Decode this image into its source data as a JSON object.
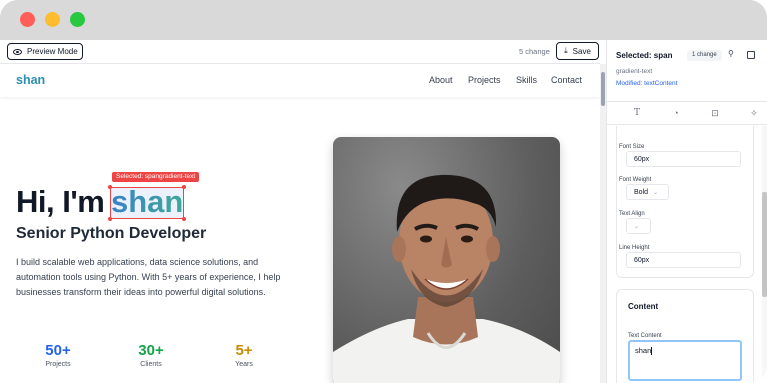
{
  "toolbar": {
    "preview_label": "Preview Mode",
    "changes_text": "5 change",
    "save_label": "Save"
  },
  "site": {
    "logo": "shan",
    "nav": [
      "About",
      "Projects",
      "Skills",
      "Contact"
    ],
    "hero": {
      "greeting": "Hi, I'm",
      "name": "shan",
      "selection_label": "Selected: spangradient-text",
      "subtitle": "Senior Python Developer",
      "description": "I build scalable web applications, data science solutions, and automation tools using Python. With 5+ years of experience, I help businesses transform their ideas into powerful digital solutions."
    },
    "stats": [
      {
        "value": "50+",
        "label": "Projects",
        "color": "#2563eb"
      },
      {
        "value": "30+",
        "label": "Clients",
        "color": "#16a34a"
      },
      {
        "value": "5+",
        "label": "Years",
        "color": "#ca8a04"
      }
    ]
  },
  "panel": {
    "title": "Selected: span",
    "badge": "1 change",
    "class_name": "gradient-text",
    "modified": "Modified: textContent",
    "fields": {
      "font_size_label": "Font Size",
      "font_size_value": "60px",
      "font_weight_label": "Font Weight",
      "font_weight_value": "Bold",
      "text_align_label": "Text Align",
      "line_height_label": "Line Height",
      "line_height_value": "60px"
    },
    "content_title": "Content",
    "text_content_label": "Text Content",
    "text_content_value": "shan"
  },
  "colors": {
    "accent_blue": "#2563eb",
    "selection_red": "#ef4444",
    "logo": "#2a8fb0"
  }
}
